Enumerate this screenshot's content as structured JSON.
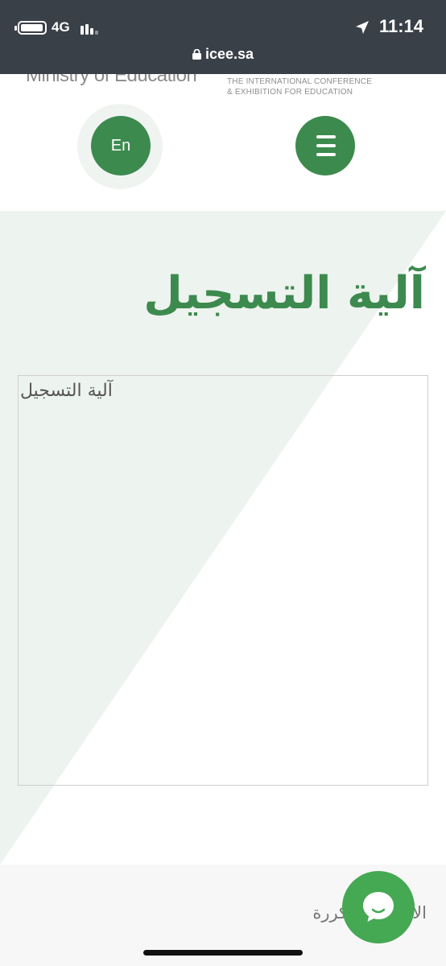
{
  "status_bar": {
    "network": "4G",
    "time": "11:14",
    "url": "icee.sa",
    "icons": [
      "battery-icon",
      "signal-icon",
      "location-arrow-icon",
      "lock-icon"
    ]
  },
  "header": {
    "ministry_logo_text": "Ministry of Education",
    "conference_line1": "THE INTERNATIONAL CONFERENCE",
    "conference_line2": "& EXHIBITION FOR EDUCATION",
    "lang_button": "En",
    "menu_icon": "hamburger-icon"
  },
  "main": {
    "page_title": "آلية التسجيل",
    "embed_title": "آلية التسجيل"
  },
  "footer": {
    "faq_label": "الأسئلة المتكررة",
    "chat_icon": "chat-bubble-icon"
  },
  "colors": {
    "brand_green": "#3d8a4e",
    "chat_green": "#45a853",
    "status_bar_bg": "#3a4048",
    "diagonal_tint": "#edf3ef"
  }
}
